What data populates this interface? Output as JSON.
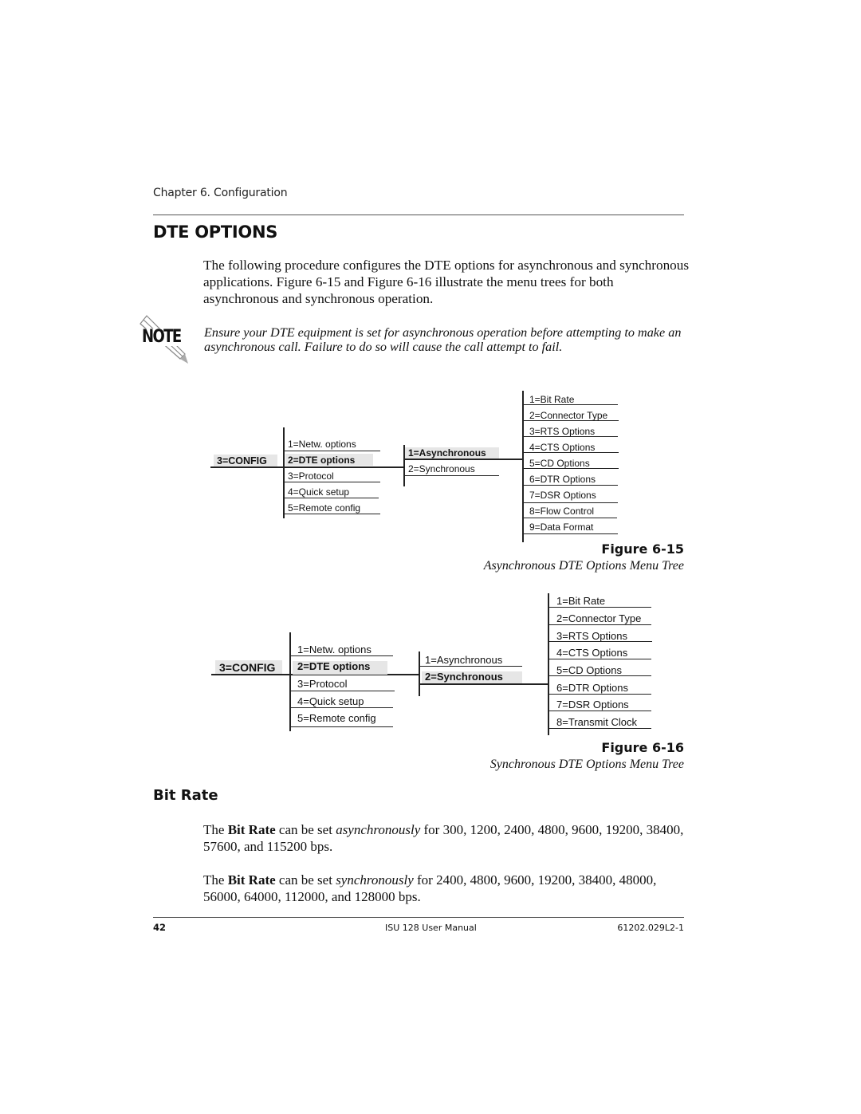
{
  "header": {
    "chapter": "Chapter 6. Configuration"
  },
  "section": {
    "title": "DTE OPTIONS",
    "intro": "The following procedure configures the DTE options for asynchronous and synchronous applications.  Figure 6-15 and Figure 6-16 illustrate the menu trees for both asynchronous and synchronous operation."
  },
  "note": {
    "icon": "note-pencil-icon",
    "label": "NOTE",
    "text": "Ensure your DTE equipment is set for asynchronous operation before attempting to make an asynchronous call.  Failure to do so will cause the call attempt to fail."
  },
  "figure15": {
    "root": "3=CONFIG",
    "config_items": [
      "1=Netw. options",
      "2=DTE options",
      "3=Protocol",
      "4=Quick setup",
      "5=Remote config"
    ],
    "selected_config": "2=DTE options",
    "mode_items": [
      "1=Asynchronous",
      "2=Synchronous"
    ],
    "selected_mode": "1=Asynchronous",
    "option_items": [
      "1=Bit Rate",
      "2=Connector Type",
      "3=RTS Options",
      "4=CTS Options",
      "5=CD Options",
      "6=DTR Options",
      "7=DSR Options",
      "8=Flow Control",
      "9=Data Format"
    ],
    "number": "Figure 6-15",
    "caption": "Asynchronous DTE Options Menu Tree"
  },
  "figure16": {
    "root": "3=CONFIG",
    "config_items": [
      "1=Netw. options",
      "2=DTE options",
      "3=Protocol",
      "4=Quick setup",
      "5=Remote config"
    ],
    "selected_config": "2=DTE options",
    "mode_items": [
      "1=Asynchronous",
      "2=Synchronous"
    ],
    "selected_mode": "2=Synchronous",
    "option_items": [
      "1=Bit Rate",
      "2=Connector Type",
      "3=RTS Options",
      "4=CTS Options",
      "5=CD Options",
      "6=DTR Options",
      "7=DSR Options",
      "8=Transmit Clock"
    ],
    "number": "Figure 6-16",
    "caption": "Synchronous DTE Options Menu Tree"
  },
  "bit_rate": {
    "heading": "Bit Rate",
    "para1": {
      "pre": "The ",
      "bold": "Bit Rate",
      "mid": " can be set ",
      "italic": "asynchronously",
      "post": " for 300, 1200, 2400, 4800, 9600, 19200, 38400, 57600, and 115200 bps."
    },
    "para2": {
      "pre": "The ",
      "bold": "Bit Rate",
      "mid": " can be set ",
      "italic": "synchronously",
      "post": " for 2400, 4800, 9600, 19200, 38400, 48000, 56000, 64000, 112000, and 128000 bps."
    }
  },
  "footer": {
    "page_number": "42",
    "manual_title": "ISU 128 User Manual",
    "doc_number": "61202.029L2-1"
  }
}
